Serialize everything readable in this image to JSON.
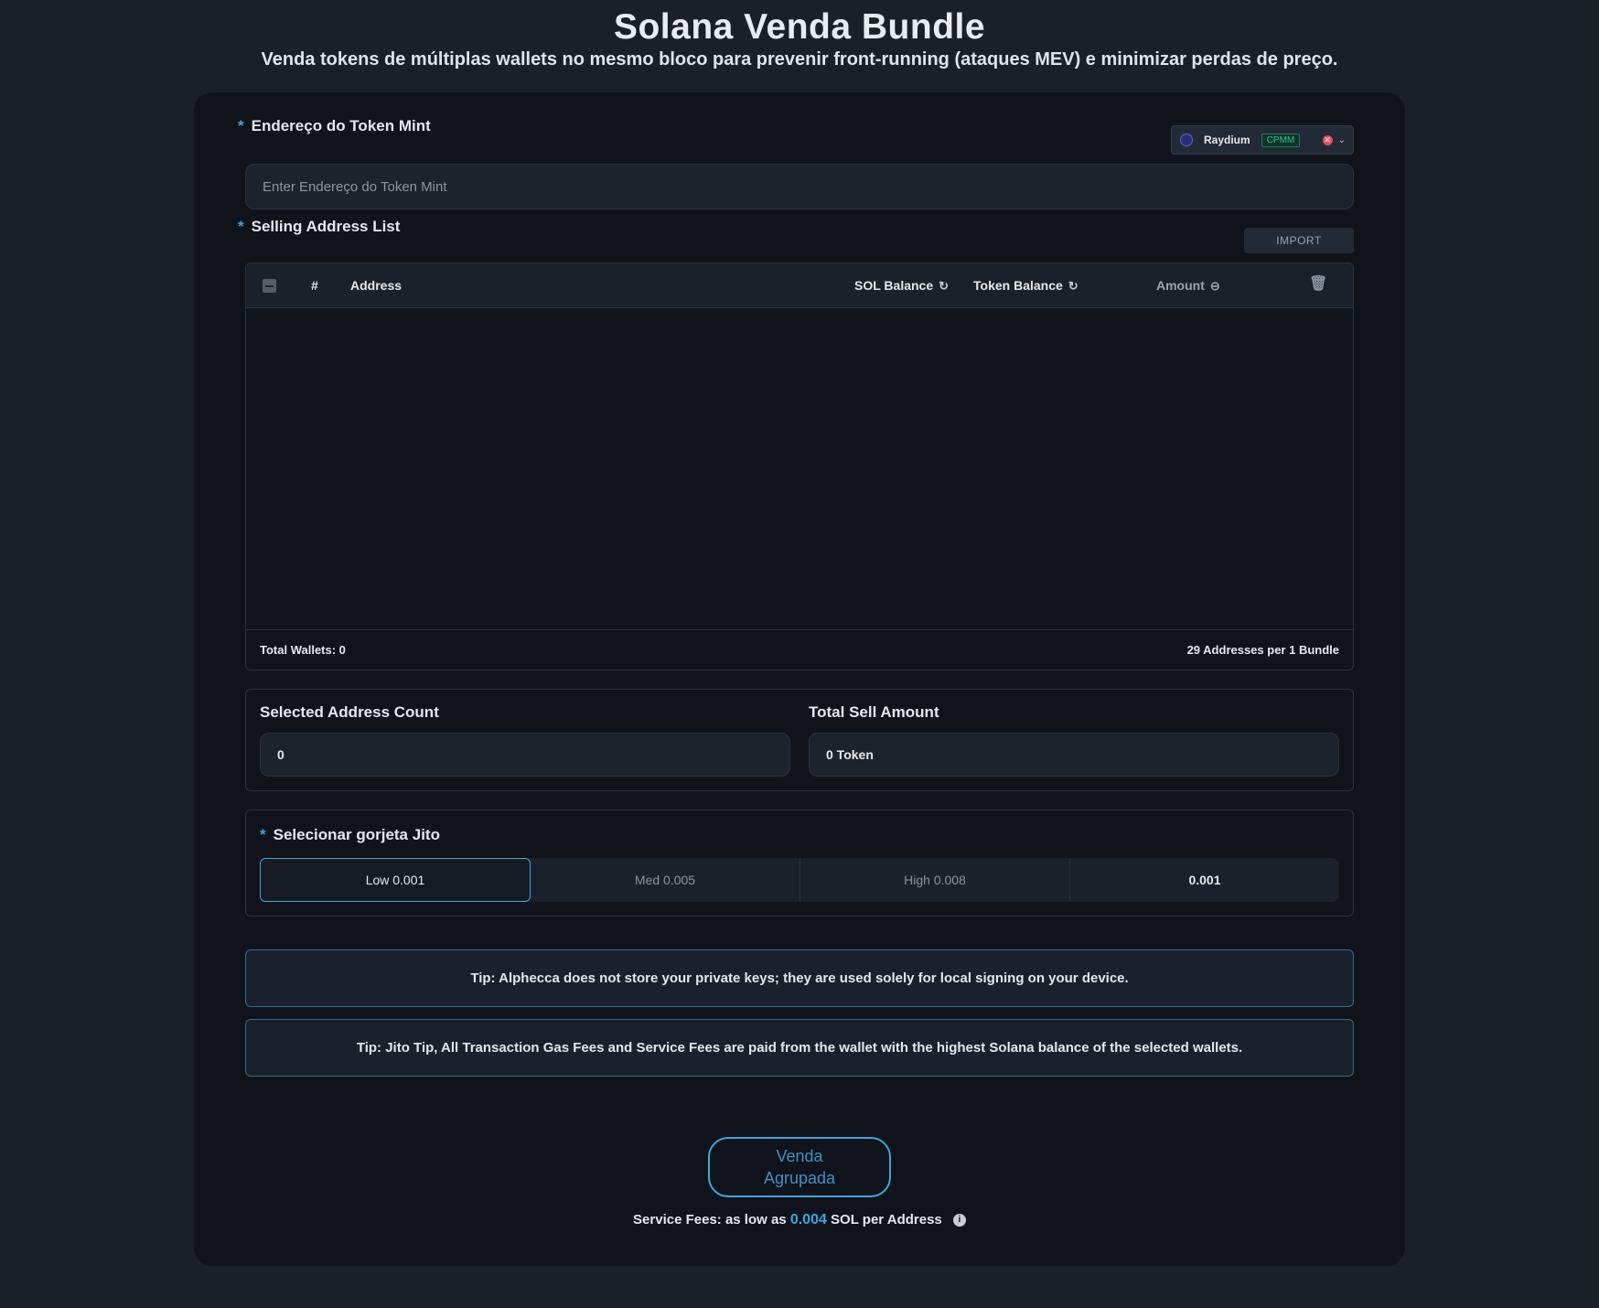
{
  "header": {
    "title": "Solana Venda Bundle",
    "subtitle": "Venda tokens de múltiplas wallets no mesmo bloco para prevenir front-running (ataques MEV) e minimizar perdas de preço."
  },
  "mint": {
    "label": "Endereço do Token Mint",
    "placeholder": "Enter Endereço do Token Mint",
    "dex": {
      "name": "Raydium",
      "tag": "CPMM",
      "clear_glyph": "✕",
      "chevron_glyph": "⌄"
    }
  },
  "selling_list": {
    "label": "Selling Address List",
    "import_label": "IMPORT",
    "columns": {
      "index": "#",
      "address": "Address",
      "sol_balance": "SOL Balance",
      "token_balance": "Token Balance",
      "amount": "Amount"
    },
    "refresh_glyph": "↻",
    "amount_glyph": "⊖",
    "trash_glyph": "🗑",
    "rows": [],
    "total_wallets": "Total Wallets: 0",
    "bundle_info": "29 Addresses per 1 Bundle"
  },
  "stats": {
    "selected_label": "Selected Address Count",
    "selected_value": "0",
    "total_label": "Total Sell Amount",
    "total_value": "0 Token"
  },
  "jito": {
    "label": "Selecionar gorjeta Jito",
    "options": [
      "Low 0.001",
      "Med 0.005",
      "High 0.008",
      "0.001"
    ],
    "selected_index": 0
  },
  "notices": [
    "Tip: Alphecca does not store your private keys; they are used solely for local signing on your device.",
    "Tip: Jito Tip, All Transaction Gas Fees and Service Fees are paid from the wallet with the highest Solana balance of the selected wallets."
  ],
  "submit": {
    "label": "Venda Agrupada"
  },
  "fees": {
    "prefix": "Service Fees: as low as",
    "value": "0.004",
    "suffix": "SOL per Address",
    "info_glyph": "i"
  },
  "colors": {
    "background": "#1b1f26",
    "panel": "#10131a",
    "accent": "#3aa7e0",
    "tag_green": "#21c98a",
    "clear_red": "#e64d5a"
  }
}
